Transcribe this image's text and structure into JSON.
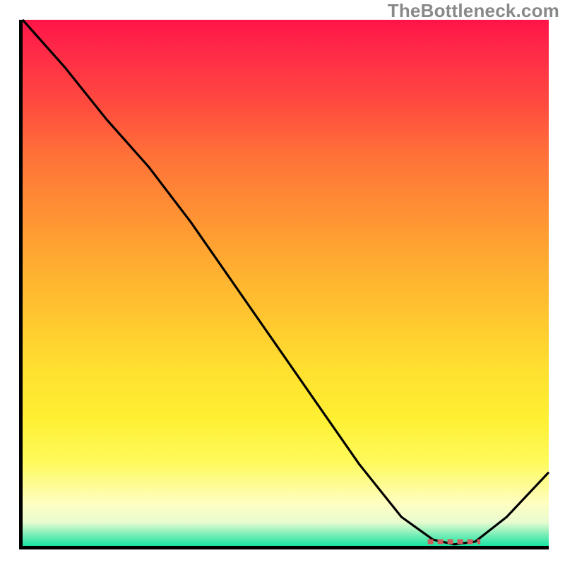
{
  "watermark": "TheBottleneck.com",
  "chart_data": {
    "type": "line",
    "title": "",
    "xlabel": "",
    "ylabel": "",
    "xlim": [
      0,
      100
    ],
    "ylim": [
      0,
      100
    ],
    "grid": false,
    "legend": false,
    "series": [
      {
        "name": "bottleneck-curve",
        "x": [
          0,
          8,
          16,
          24,
          32,
          40,
          48,
          56,
          64,
          72,
          78,
          82,
          86,
          92,
          100
        ],
        "y": [
          100,
          91,
          81,
          72,
          61.5,
          50,
          38.5,
          27,
          15.5,
          5.5,
          1.2,
          0.3,
          0.8,
          5.5,
          14
        ]
      }
    ],
    "annotations": [
      {
        "name": "optimal-range-marker",
        "style": "dashed-red",
        "x_start": 77,
        "x_end": 87,
        "y": 0.8
      }
    ]
  }
}
